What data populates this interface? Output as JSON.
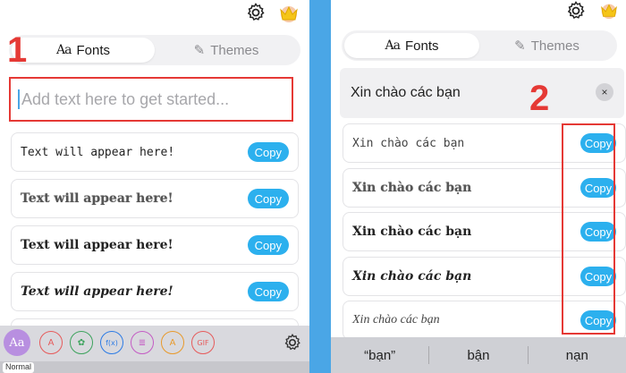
{
  "left": {
    "tabs": [
      {
        "label": "Fonts",
        "glyph": "Aa",
        "active": true
      },
      {
        "label": "Themes",
        "glyph": "✎",
        "active": false
      }
    ],
    "step_number": "1",
    "input": {
      "placeholder": "Add text here to get started..."
    },
    "results": [
      {
        "text": "Text will appear here!",
        "copy_label": "Copy"
      },
      {
        "text": "Text will appear here!",
        "copy_label": "Copy"
      },
      {
        "text": "Text will appear here!",
        "copy_label": "Copy"
      },
      {
        "text": "Text will appear here!",
        "copy_label": "Copy"
      }
    ],
    "toolbar": {
      "tools": [
        "Aa",
        "A",
        "✿",
        "f(x)",
        "≣",
        "A",
        "GIF"
      ],
      "bottom_tab": "Normal"
    }
  },
  "right": {
    "tabs": [
      {
        "label": "Fonts",
        "glyph": "Aa",
        "active": true
      },
      {
        "label": "Themes",
        "glyph": "✎",
        "active": false
      }
    ],
    "step_number": "2",
    "input_text": "Xin chào các bạn",
    "clear_label": "×",
    "results": [
      {
        "text": "Xin chào các bạn",
        "copy_label": "Copy"
      },
      {
        "text": "Xin chào các bạn",
        "copy_label": "Copy"
      },
      {
        "text": "Xin chào các bạn",
        "copy_label": "Copy"
      },
      {
        "text": "Xin chào các bạn",
        "copy_label": "Copy"
      },
      {
        "text": "Xin chào các bạn",
        "copy_label": "Copy"
      }
    ],
    "suggestions": [
      "“bạn”",
      "bận",
      "nạn"
    ]
  },
  "colors": {
    "accent": "#2cb0ee",
    "annotation_red": "#e53935",
    "divider_blue": "#4aa6e6",
    "toolbar_bg": "#d9d9de"
  }
}
